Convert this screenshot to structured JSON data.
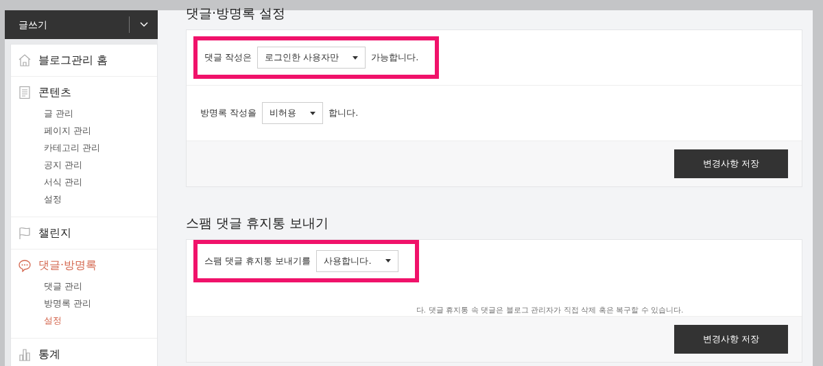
{
  "write_button": {
    "label": "글쓰기"
  },
  "sidebar": {
    "groups": [
      {
        "title": "블로그관리 홈",
        "selected": false
      },
      {
        "title": "콘텐츠",
        "selected": false,
        "items": [
          {
            "label": "글 관리",
            "selected": false
          },
          {
            "label": "페이지 관리",
            "selected": false
          },
          {
            "label": "카테고리 관리",
            "selected": false
          },
          {
            "label": "공지 관리",
            "selected": false
          },
          {
            "label": "서식 관리",
            "selected": false
          },
          {
            "label": "설정",
            "selected": false
          }
        ]
      },
      {
        "title": "챌린지",
        "selected": false
      },
      {
        "title": "댓글·방명록",
        "selected": true,
        "items": [
          {
            "label": "댓글 관리",
            "selected": false
          },
          {
            "label": "방명록 관리",
            "selected": false
          },
          {
            "label": "설정",
            "selected": true
          }
        ]
      },
      {
        "title": "통계",
        "selected": false
      }
    ]
  },
  "sections": [
    {
      "title": "댓글·방명록 설정",
      "rows": [
        {
          "before": "댓글 작성은",
          "value": "로그인한 사용자만",
          "after": "가능합니다.",
          "highlighted": true
        },
        {
          "before": "방명록 작성을",
          "value": "비허용",
          "after": "합니다."
        }
      ],
      "save_button": "변경사항 저장"
    },
    {
      "title": "스팸 댓글 휴지통 보내기",
      "rows": [
        {
          "before": "스팸 댓글 휴지통 보내기를",
          "value": "사용합니다.",
          "highlighted": true,
          "note": "다. 댓글 휴지통 속 댓글은 블로그 관리자가 직접 삭제 혹은 복구할 수 있습니다."
        }
      ],
      "save_button": "변경사항 저장"
    }
  ]
}
